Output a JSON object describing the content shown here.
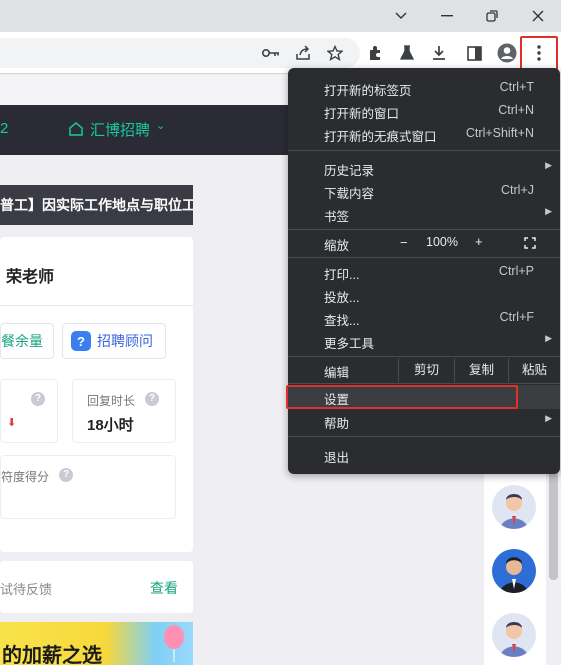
{
  "window_controls": {
    "minimize": "—",
    "maximize": "❐",
    "close": "✕",
    "tab_list": "⌄"
  },
  "toolbar": {
    "icons": [
      "key-icon",
      "share-icon",
      "star-icon",
      "extensions-icon",
      "labs-flask-icon",
      "download-icon",
      "side-panel-icon",
      "profile-icon",
      "menu-dots-icon"
    ]
  },
  "header": {
    "number_fragment": "2",
    "brand": "汇博招聘",
    "caret": "⌄"
  },
  "banner": {
    "text": "普工】因实际工作地点与职位工"
  },
  "profile_card": {
    "teacher": "荣老师",
    "pill_a": "餐余量",
    "pill_b": "招聘顾问",
    "pill_b_badge": "?",
    "stat_b_label": "回复时长",
    "stat_b_value": "18小时",
    "score_label": "符度得分",
    "help": "?"
  },
  "feedback": {
    "label": "试待反馈",
    "link": "查看"
  },
  "promo": {
    "text": "的加薪之选"
  },
  "menu": {
    "new_tab": "打开新的标签页",
    "new_tab_sc": "Ctrl+T",
    "new_window": "打开新的窗口",
    "new_window_sc": "Ctrl+N",
    "incognito": "打开新的无痕式窗口",
    "incognito_sc": "Ctrl+Shift+N",
    "history": "历史记录",
    "downloads": "下载内容",
    "downloads_sc": "Ctrl+J",
    "bookmarks": "书签",
    "zoom": "缩放",
    "zoom_minus": "−",
    "zoom_level": "100%",
    "zoom_plus": "+",
    "print": "打印...",
    "print_sc": "Ctrl+P",
    "cast": "投放...",
    "find": "查找...",
    "find_sc": "Ctrl+F",
    "more_tools": "更多工具",
    "edit": "编辑",
    "cut": "剪切",
    "copy": "复制",
    "paste": "粘贴",
    "settings": "设置",
    "help": "帮助",
    "exit": "退出"
  },
  "colors": {
    "accent_green": "#18c9a0",
    "highlight_red": "#e0302b",
    "menu_bg": "#2b2c2f",
    "header_bg": "#2a2b35"
  }
}
